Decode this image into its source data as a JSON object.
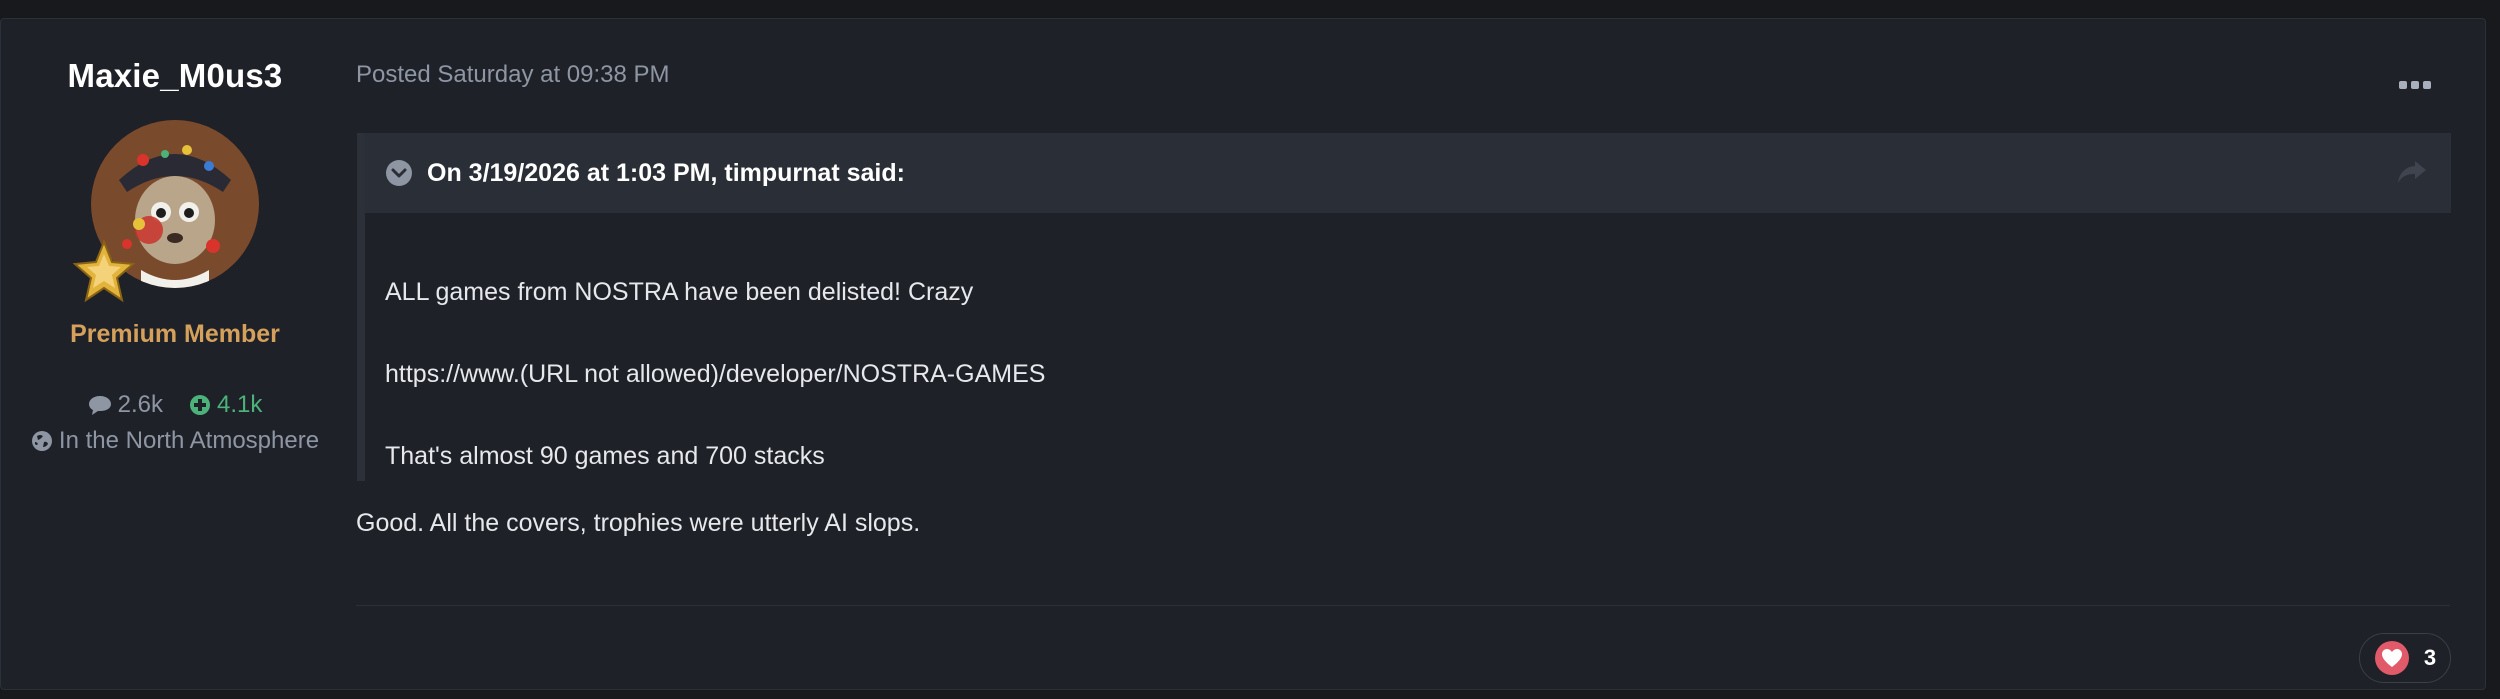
{
  "author": {
    "name": "Maxie_M0us3",
    "title": "Premium Member",
    "posts_count": "2.6k",
    "reputation": "4.1k",
    "location": "In the North Atmosphere"
  },
  "post": {
    "meta": "Posted Saturday at 09:38 PM",
    "quote": {
      "citation": "On 3/19/2026 at 1:03 PM, timpurnat said:",
      "lines": [
        "ALL games from NOSTRA have been delisted! Crazy",
        "https://www.(URL not allowed)/developer/NOSTRA-GAMES",
        "That's almost 90 games and 700 stacks"
      ]
    },
    "text": "Good. All the covers, trophies were utterly AI slops."
  },
  "reactions": {
    "count": "3",
    "icon": "heart-icon"
  },
  "colors": {
    "background": "#17191d",
    "panel": "#1e2128",
    "quote_header": "#2a2e36",
    "member_title": "#d4a05c",
    "reputation": "#4bb27a",
    "muted_text": "#8f96a3"
  }
}
